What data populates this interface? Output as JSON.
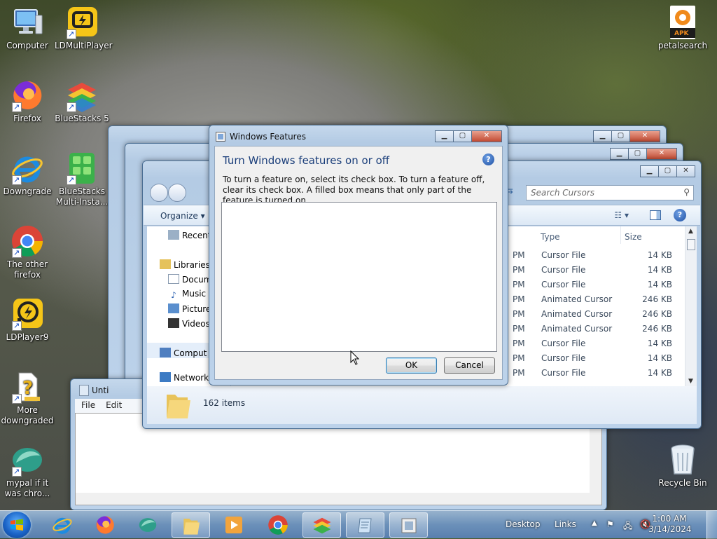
{
  "desktop": {
    "icons": {
      "computer": "Computer",
      "ldmultiplayer": "LDMultiPlayer",
      "petalsearch": "petalsearch",
      "petalsearch_badge": "APK",
      "firefox": "Firefox",
      "bluestacks5": "BlueStacks 5",
      "downgrade": "Downgrade",
      "bluestacks_multi": "BlueStacks Multi-Insta...",
      "other_firefox": "The other firefox",
      "ldplayer9": "LDPlayer9",
      "more_downgraded": "More downgraded",
      "mypal": "mypal if it was chro...",
      "recycle_bin": "Recycle Bin"
    }
  },
  "explorer": {
    "search_placeholder": "Search Cursors",
    "toolbar": {
      "organize": "Organize"
    },
    "nav": {
      "recent": "Recent",
      "libraries": "Libraries",
      "documents": "Docum",
      "music": "Music",
      "pictures": "Picture",
      "videos": "Videos",
      "computer": "Comput",
      "network": "Network"
    },
    "columns": {
      "type": "Type",
      "size": "Size"
    },
    "rows": [
      {
        "pm": "PM",
        "type": "Cursor File",
        "size": "14 KB"
      },
      {
        "pm": "PM",
        "type": "Cursor File",
        "size": "14 KB"
      },
      {
        "pm": "PM",
        "type": "Cursor File",
        "size": "14 KB"
      },
      {
        "pm": "PM",
        "type": "Animated Cursor",
        "size": "246 KB"
      },
      {
        "pm": "PM",
        "type": "Animated Cursor",
        "size": "246 KB"
      },
      {
        "pm": "PM",
        "type": "Animated Cursor",
        "size": "246 KB"
      },
      {
        "pm": "PM",
        "type": "Cursor File",
        "size": "14 KB"
      },
      {
        "pm": "PM",
        "type": "Cursor File",
        "size": "14 KB"
      },
      {
        "pm": "PM",
        "type": "Cursor File",
        "size": "14 KB"
      }
    ],
    "status": {
      "count": "162 items"
    }
  },
  "notepad": {
    "title": "Unti",
    "menu": {
      "file": "File",
      "edit": "Edit"
    }
  },
  "features_dialog": {
    "title": "Windows Features",
    "heading": "Turn Windows features on or off",
    "description": "To turn a feature on, select its check box. To turn a feature off, clear its check box. A filled box means that only part of the feature is turned on.",
    "ok": "OK",
    "cancel": "Cancel"
  },
  "taskbar": {
    "desktop": "Desktop",
    "links": "Links",
    "time": "1:00 AM",
    "date": "3/14/2024"
  }
}
